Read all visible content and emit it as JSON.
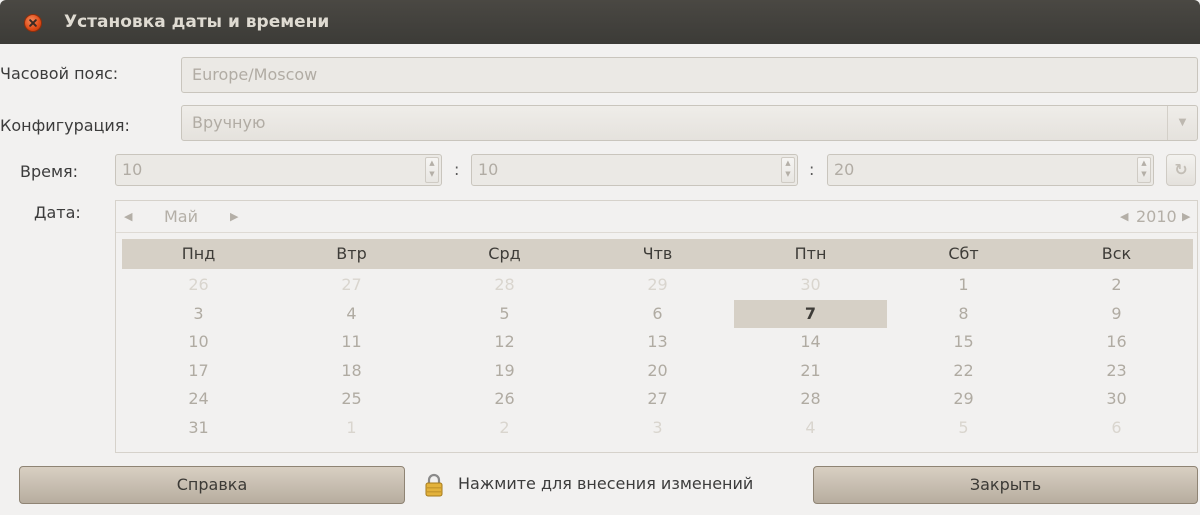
{
  "window": {
    "title": "Установка даты и времени"
  },
  "timezone": {
    "label": "Часовой пояс:",
    "value": "Europe/Moscow"
  },
  "configuration": {
    "label": "Конфигурация:",
    "value": "Вручную"
  },
  "time": {
    "label": "Время:",
    "hours": "10",
    "minutes": "10",
    "seconds": "20",
    "separator": ":"
  },
  "date": {
    "label": "Дата:",
    "month": "Май",
    "year": "2010",
    "weekdays": [
      "Пнд",
      "Втр",
      "Срд",
      "Чтв",
      "Птн",
      "Сбт",
      "Вск"
    ],
    "weeks": [
      [
        {
          "d": "26",
          "o": true
        },
        {
          "d": "27",
          "o": true
        },
        {
          "d": "28",
          "o": true
        },
        {
          "d": "29",
          "o": true
        },
        {
          "d": "30",
          "o": true
        },
        {
          "d": "1"
        },
        {
          "d": "2"
        }
      ],
      [
        {
          "d": "3"
        },
        {
          "d": "4"
        },
        {
          "d": "5"
        },
        {
          "d": "6"
        },
        {
          "d": "7",
          "s": true
        },
        {
          "d": "8"
        },
        {
          "d": "9"
        }
      ],
      [
        {
          "d": "10"
        },
        {
          "d": "11"
        },
        {
          "d": "12"
        },
        {
          "d": "13"
        },
        {
          "d": "14"
        },
        {
          "d": "15"
        },
        {
          "d": "16"
        }
      ],
      [
        {
          "d": "17"
        },
        {
          "d": "18"
        },
        {
          "d": "19"
        },
        {
          "d": "20"
        },
        {
          "d": "21"
        },
        {
          "d": "22"
        },
        {
          "d": "23"
        }
      ],
      [
        {
          "d": "24"
        },
        {
          "d": "25"
        },
        {
          "d": "26"
        },
        {
          "d": "27"
        },
        {
          "d": "28"
        },
        {
          "d": "29"
        },
        {
          "d": "30"
        }
      ],
      [
        {
          "d": "31"
        },
        {
          "d": "1",
          "o": true
        },
        {
          "d": "2",
          "o": true
        },
        {
          "d": "3",
          "o": true
        },
        {
          "d": "4",
          "o": true
        },
        {
          "d": "5",
          "o": true
        },
        {
          "d": "6",
          "o": true
        }
      ]
    ]
  },
  "buttons": {
    "help": "Справка",
    "unlock": "Нажмите для внесения изменений",
    "close": "Закрыть"
  },
  "icons": {
    "close": "close-icon",
    "lock": "lock-icon",
    "refresh": "refresh-icon",
    "dropdown": "chevron-down-icon"
  }
}
